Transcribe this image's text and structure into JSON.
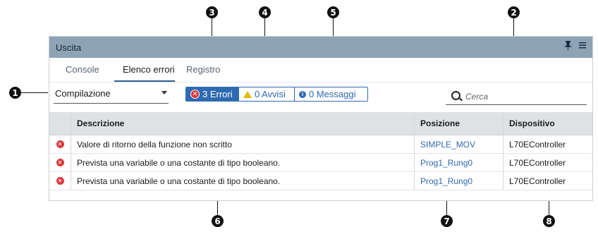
{
  "callouts": [
    "1",
    "2",
    "3",
    "4",
    "5",
    "6",
    "7",
    "8"
  ],
  "panel": {
    "title": "Uscita",
    "pin_icon": "pin-icon",
    "menu_icon": "menu-icon"
  },
  "tabs": [
    {
      "label": "Console",
      "active": false
    },
    {
      "label": "Elenco errori",
      "active": true
    },
    {
      "label": "Registro",
      "active": false
    }
  ],
  "toolbar": {
    "compile_select": "Compilazione",
    "filters": {
      "errors": "3 Errori",
      "warnings": "0 Avvisi",
      "messages": "0 Messaggi"
    },
    "search_placeholder": "Cerca"
  },
  "table": {
    "headers": [
      "Descrizione",
      "Posizione",
      "Dispositivo"
    ],
    "rows": [
      {
        "description": "Valore di ritorno della funzione non scritto",
        "position": "SIMPLE_MOV",
        "device": "L70EController"
      },
      {
        "description": "Prevista una variabile o una costante di tipo booleano.",
        "position": "Prog1_Rung0",
        "device": "L70EController"
      },
      {
        "description": "Prevista una variabile o una costante di tipo booleano.",
        "position": "Prog1_Rung0",
        "device": "L70EController"
      }
    ]
  },
  "colors": {
    "titlebar": "#8ea3b5",
    "accent": "#2f6ab1",
    "error": "#d8393b",
    "warning": "#e6b800"
  }
}
